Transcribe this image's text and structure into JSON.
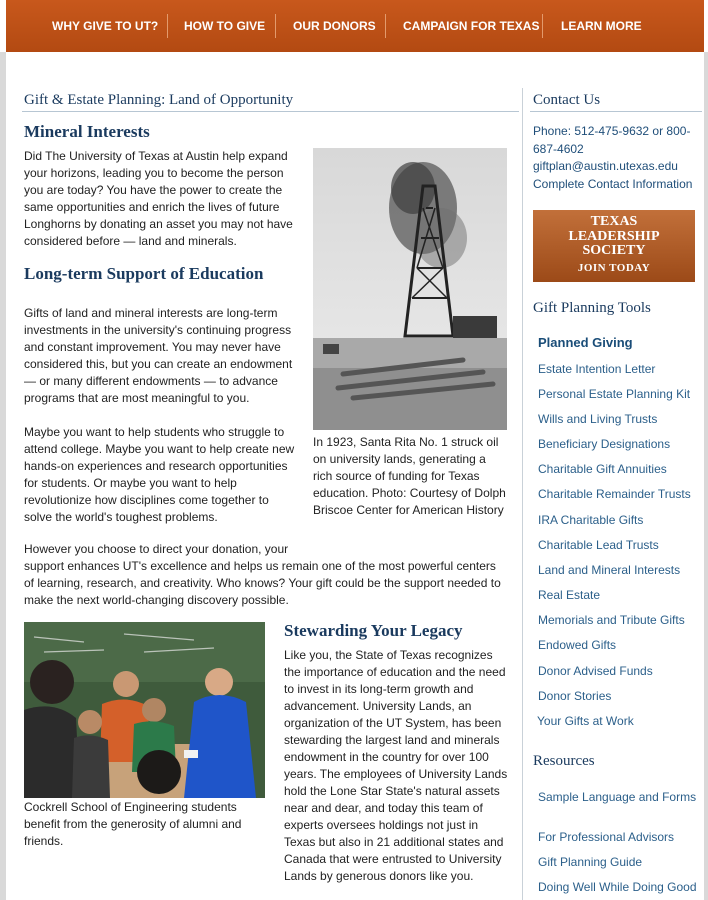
{
  "nav": {
    "items": [
      "WHY GIVE TO UT?",
      "HOW TO GIVE",
      "OUR DONORS",
      "CAMPAIGN FOR TEXAS",
      "LEARN MORE"
    ]
  },
  "page": {
    "title": "Gift & Estate Planning: Land of Opportunity"
  },
  "main": {
    "mineral_heading": "Mineral Interests",
    "mineral_text": "Did The University of Texas at Austin help expand your horizons, leading you to become the person you are today? You have the power to create the same opportunities and enrich the lives of future Longhorns by donating an asset you may not have considered before — land and minerals.",
    "support_heading": "Long-term Support of Education",
    "support_text": "Gifts of land and mineral interests are long-term investments in the university's continuing progress and constant improvement. You may never have considered this, but you can create an endowment — or many different endowments — to advance programs that are most meaningful to you.",
    "maybe_text": "Maybe you want to help students who struggle to attend college. Maybe you want to help create new hands-on experiences and research opportunities for students. Or maybe you want to help revolutionize how disciplines come together to solve the world's toughest problems.",
    "however_line1": "However you choose to direct your donation, your",
    "however_rest": "support enhances UT's excellence and helps us remain one of the most powerful centers of learning, research, and creativity. Who knows? Your gift could be the support needed to make the next world-changing discovery possible.",
    "oil_caption": "In 1923, Santa Rita No. 1 struck oil on university lands, generating a rich source of funding for Texas education. Photo: Courtesy of Dolph Briscoe Center for American History",
    "students_caption": "Cockrell School of Engineering students benefit from the generosity of alumni and friends.",
    "stewarding_heading": "Stewarding Your Legacy",
    "stewarding_text": "Like you, the State of Texas recognizes the importance of education and the need to invest in its long-term growth and advancement. University Lands, an organization of the UT System, has been stewarding the largest land and minerals endowment in the country for over 100 years. The employees of University Lands hold the Lone Star State's natural assets near and dear, and today this team of experts oversees holdings not just in Texas but also in 21 additional states and Canada that were entrusted to University Lands by generous donors like you."
  },
  "sidebar": {
    "contact_heading": "Contact Us",
    "phone": "Phone: 512-475-9632 or 800-687-4602",
    "email": "giftplan@austin.utexas.edu",
    "contact_link": "Complete Contact Information",
    "banner": {
      "line1": "TEXAS",
      "line2": "LEADERSHIP",
      "line3": "SOCIETY",
      "line4": "JOIN TODAY"
    },
    "tools_heading": "Gift Planning Tools",
    "tools": [
      "Planned Giving",
      "Estate Intention Letter",
      "Personal Estate Planning Kit",
      "Wills and Living Trusts",
      "Beneficiary Designations",
      "Charitable Gift Annuities",
      "Charitable Remainder Trusts",
      "IRA Charitable Gifts",
      "Charitable Lead Trusts",
      "Land and Mineral Interests",
      "Real Estate",
      "Memorials and Tribute Gifts",
      "Endowed Gifts",
      "Donor Advised Funds",
      "Donor Stories",
      "Your Gifts at Work"
    ],
    "resources_heading": "Resources",
    "resources": [
      "Sample Language and Forms",
      "For Professional Advisors",
      "Gift Planning Guide",
      "Doing Well While Doing Good"
    ]
  },
  "colors": {
    "nav_bg": "#bf5316",
    "heading": "#1a3a5e",
    "link": "#2b5f8a"
  }
}
